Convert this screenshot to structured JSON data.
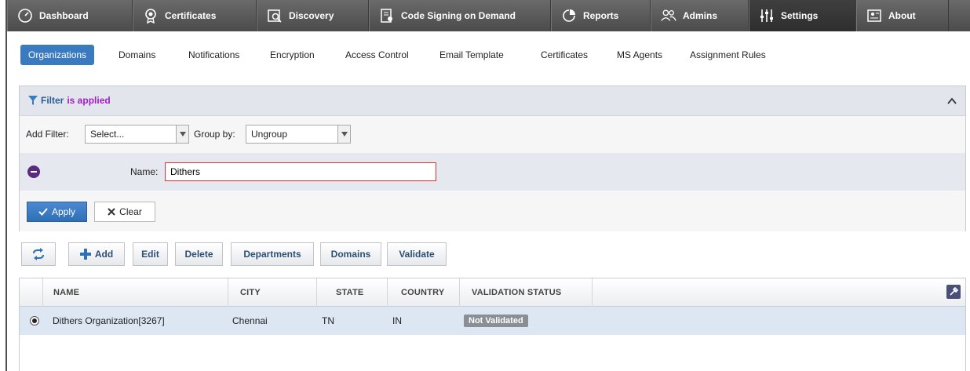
{
  "topnav": {
    "items": [
      {
        "label": "Dashboard",
        "icon": "gauge-icon"
      },
      {
        "label": "Certificates",
        "icon": "certificate-icon"
      },
      {
        "label": "Discovery",
        "icon": "discovery-icon"
      },
      {
        "label": "Code Signing on Demand",
        "icon": "code-signing-icon"
      },
      {
        "label": "Reports",
        "icon": "reports-icon"
      },
      {
        "label": "Admins",
        "icon": "admins-icon"
      },
      {
        "label": "Settings",
        "icon": "settings-sliders-icon"
      },
      {
        "label": "About",
        "icon": "about-icon"
      }
    ],
    "active": "Settings"
  },
  "subnav": {
    "tabs": [
      "Organizations",
      "Domains",
      "Notifications",
      "Encryption",
      "Access Control",
      "Email Template",
      "Certificates",
      "MS Agents",
      "Assignment Rules"
    ],
    "active": "Organizations"
  },
  "filter": {
    "title": "Filter",
    "status": "is applied",
    "add_filter_label": "Add Filter:",
    "add_filter_value": "Select...",
    "group_by_label": "Group by:",
    "group_by_value": "Ungroup",
    "name_label": "Name:",
    "name_value": "Dithers",
    "apply_label": "Apply",
    "clear_label": "Clear"
  },
  "toolbar": {
    "add_label": "Add",
    "edit_label": "Edit",
    "delete_label": "Delete",
    "departments_label": "Departments",
    "domains_label": "Domains",
    "validate_label": "Validate"
  },
  "table": {
    "columns": [
      "NAME",
      "CITY",
      "STATE",
      "COUNTRY",
      "VALIDATION STATUS"
    ],
    "rows": [
      {
        "name": "Dithers Organization[3267]",
        "city": "Chennai",
        "state": "TN",
        "country": "IN",
        "validation_status": "Not Validated",
        "selected": true
      }
    ]
  },
  "colors": {
    "nav_bg": "#555555",
    "accent": "#3a7bbf",
    "filter_applied": "#a020c0",
    "selected_row": "#dde6f3",
    "badge": "#8a8f96"
  }
}
